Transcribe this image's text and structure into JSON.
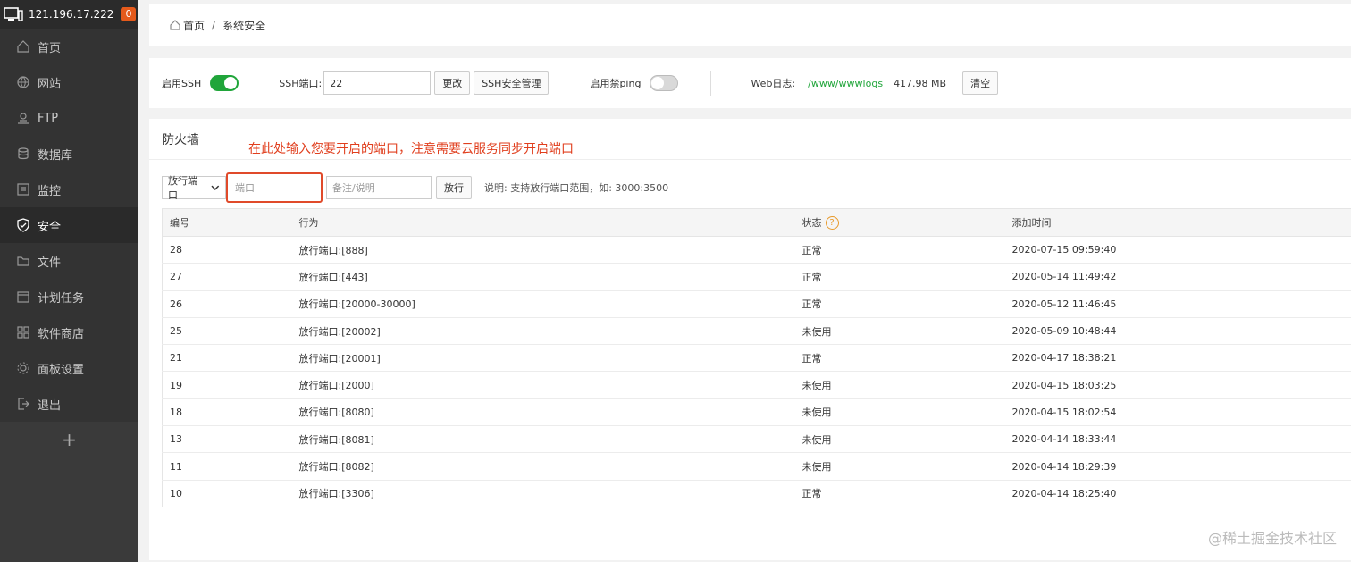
{
  "sidebar": {
    "ip": "121.196.17.222",
    "badge": "0",
    "items": [
      {
        "label": "首页",
        "icon": "home-icon"
      },
      {
        "label": "网站",
        "icon": "globe-icon"
      },
      {
        "label": "FTP",
        "icon": "ftp-icon"
      },
      {
        "label": "数据库",
        "icon": "database-icon"
      },
      {
        "label": "监控",
        "icon": "monitor-icon"
      },
      {
        "label": "安全",
        "icon": "shield-icon"
      },
      {
        "label": "文件",
        "icon": "folder-icon"
      },
      {
        "label": "计划任务",
        "icon": "calendar-icon"
      },
      {
        "label": "软件商店",
        "icon": "apps-icon"
      },
      {
        "label": "面板设置",
        "icon": "gear-icon"
      },
      {
        "label": "退出",
        "icon": "logout-icon"
      }
    ],
    "add": "+"
  },
  "breadcrumb": {
    "home": "首页",
    "sep": "/",
    "current": "系统安全"
  },
  "toolbar": {
    "ssh_label": "启用SSH",
    "ssh_port_label": "SSH端口:",
    "ssh_port_value": "22",
    "change_btn": "更改",
    "ssh_manage_btn": "SSH安全管理",
    "ping_label": "启用禁ping",
    "weblog_label": "Web日志:",
    "weblog_path": "/www/wwwlogs",
    "weblog_size": "417.98 MB",
    "clear_btn": "清空"
  },
  "firewall": {
    "title": "防火墙",
    "annotation": "在此处输入您要开启的端口，注意需要云服务同步开启端口",
    "select_value": "放行端口",
    "port_placeholder": "端口",
    "note_placeholder": "备注/说明",
    "allow_btn": "放行",
    "hint": "说明: 支持放行端口范围，如: 3000:3500",
    "columns": [
      "编号",
      "行为",
      "状态",
      "添加时间"
    ],
    "help_icon": "?",
    "rows": [
      [
        "28",
        "放行端口:[888]",
        "正常",
        "2020-07-15 09:59:40"
      ],
      [
        "27",
        "放行端口:[443]",
        "正常",
        "2020-05-14 11:49:42"
      ],
      [
        "26",
        "放行端口:[20000-30000]",
        "正常",
        "2020-05-12 11:46:45"
      ],
      [
        "25",
        "放行端口:[20002]",
        "未使用",
        "2020-05-09 10:48:44"
      ],
      [
        "21",
        "放行端口:[20001]",
        "正常",
        "2020-04-17 18:38:21"
      ],
      [
        "19",
        "放行端口:[2000]",
        "未使用",
        "2020-04-15 18:03:25"
      ],
      [
        "18",
        "放行端口:[8080]",
        "未使用",
        "2020-04-15 18:02:54"
      ],
      [
        "13",
        "放行端口:[8081]",
        "未使用",
        "2020-04-14 18:33:44"
      ],
      [
        "11",
        "放行端口:[8082]",
        "未使用",
        "2020-04-14 18:29:39"
      ],
      [
        "10",
        "放行端口:[3306]",
        "正常",
        "2020-04-14 18:25:40"
      ]
    ]
  },
  "watermark": "@稀土掘金技术社区"
}
